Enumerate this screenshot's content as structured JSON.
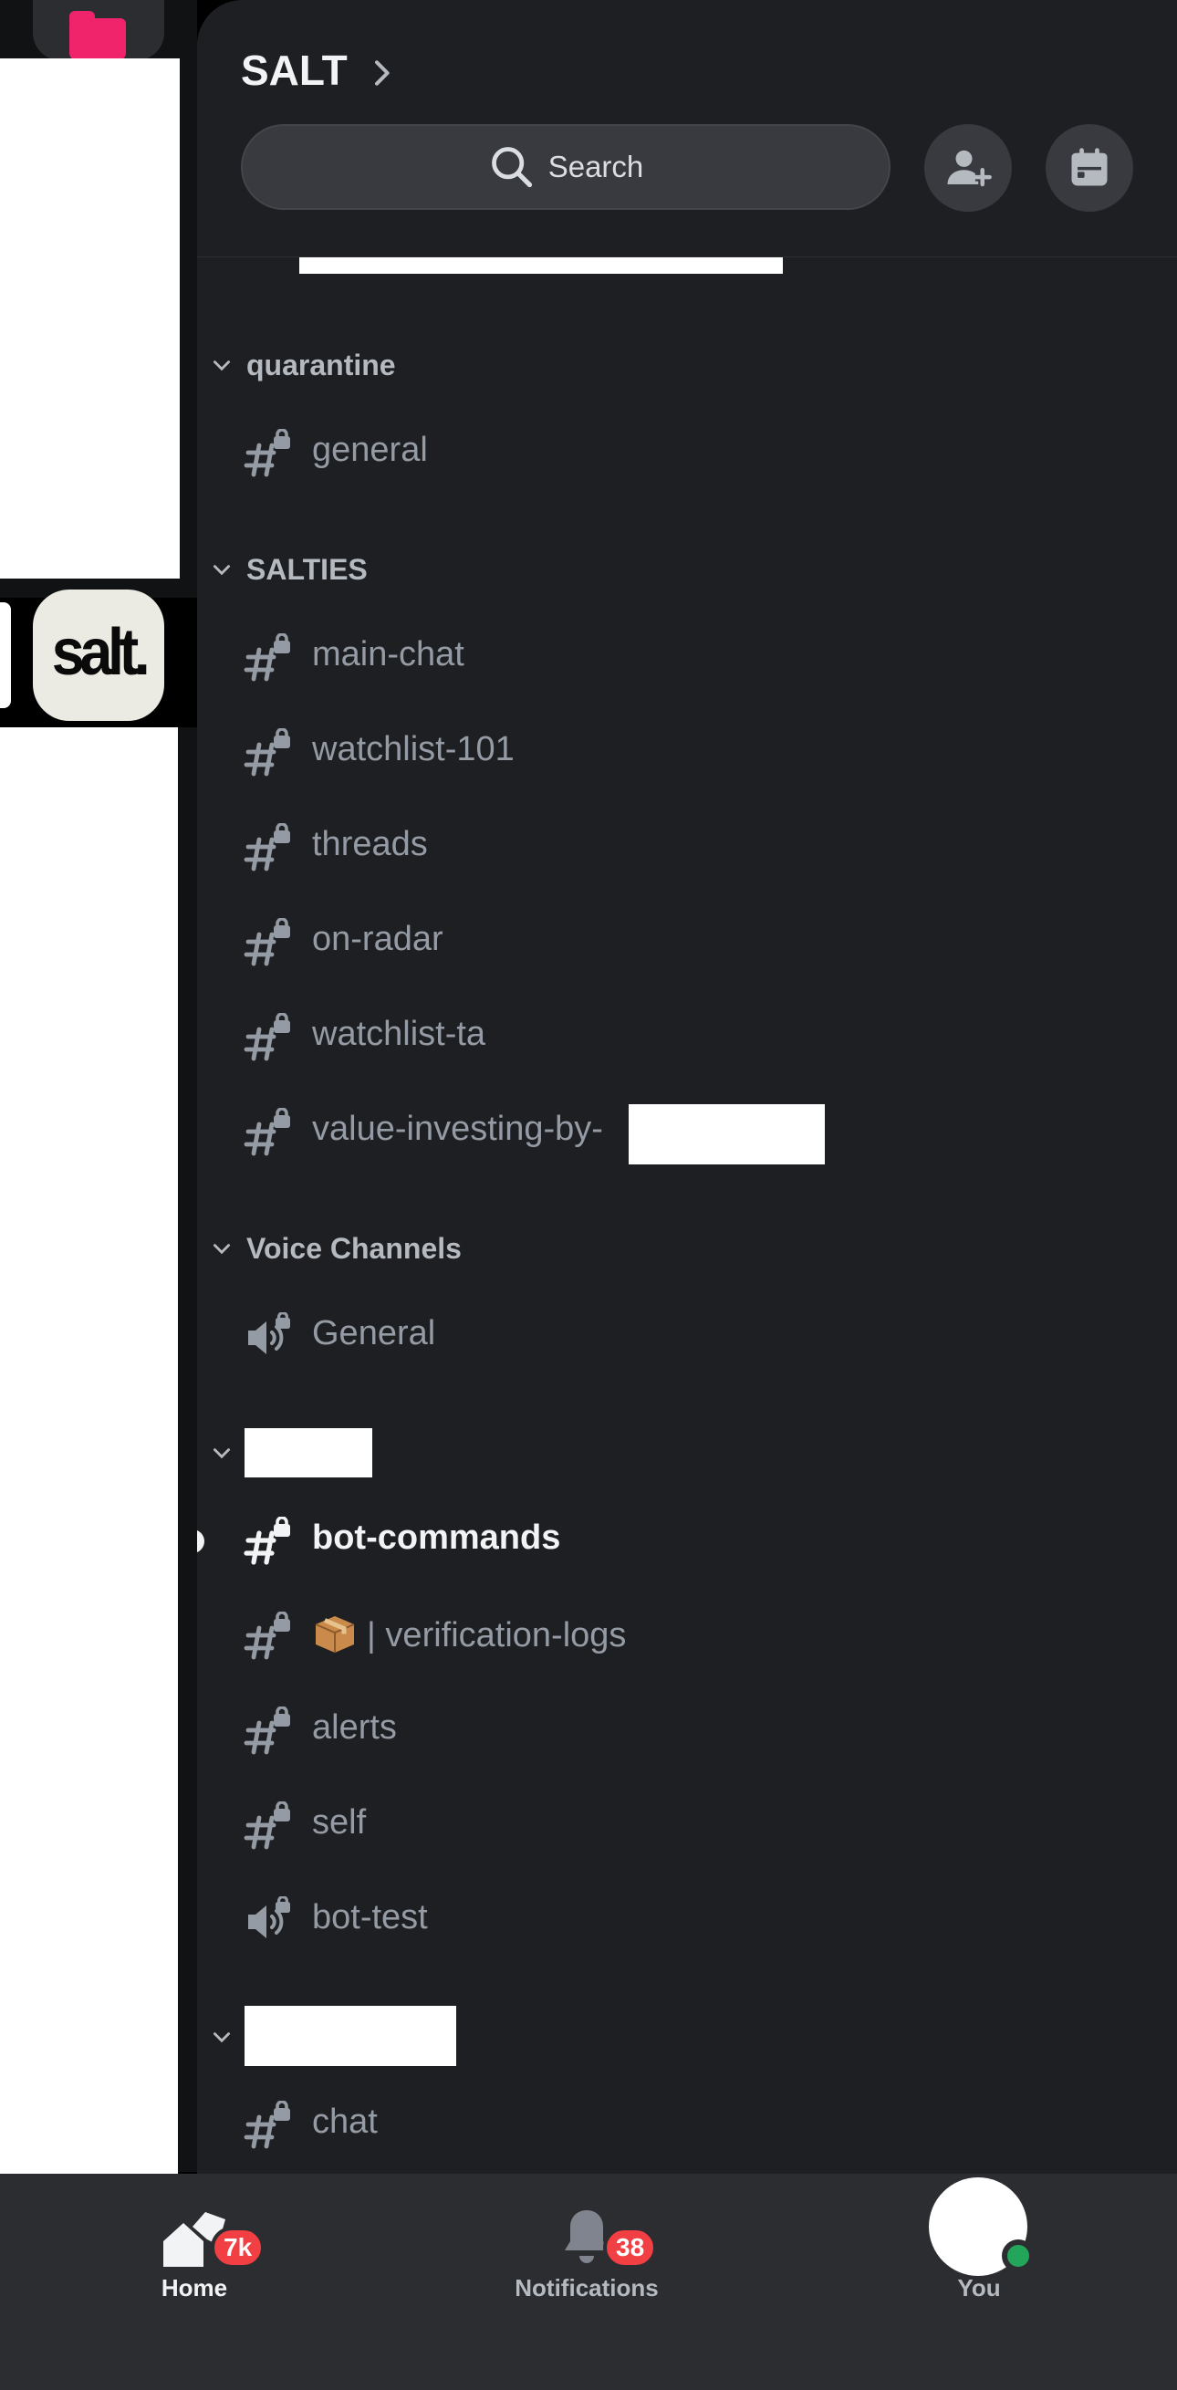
{
  "server": {
    "name": "SALT",
    "icon_text": "salt."
  },
  "search": {
    "label": "Search"
  },
  "actions": {
    "invite_icon": "add-member-icon",
    "events_icon": "calendar-icon"
  },
  "categories": {
    "quarantine": {
      "label": "quarantine",
      "channels": [
        {
          "name": "general",
          "type": "text-locked"
        }
      ]
    },
    "salties": {
      "label": "SALTIES",
      "channels": [
        {
          "name": "main-chat",
          "type": "text-locked"
        },
        {
          "name": "watchlist-101",
          "type": "text-locked"
        },
        {
          "name": "threads",
          "type": "text-locked"
        },
        {
          "name": "on-radar",
          "type": "text-locked"
        },
        {
          "name": "watchlist-ta",
          "type": "text-locked"
        },
        {
          "name": "value-investing-by-",
          "type": "text-locked"
        }
      ]
    },
    "voice": {
      "label": "Voice Channels",
      "channels": [
        {
          "name": "General",
          "type": "voice-locked"
        }
      ]
    },
    "bots": {
      "label": "",
      "channels": [
        {
          "name": "bot-commands",
          "type": "text-locked",
          "unread": true
        },
        {
          "name": "| verification-logs",
          "type": "text-locked",
          "emoji": "package"
        },
        {
          "name": "alerts",
          "type": "text-locked"
        },
        {
          "name": "self",
          "type": "text-locked"
        },
        {
          "name": "bot-test",
          "type": "voice-locked"
        }
      ]
    },
    "last": {
      "label": "",
      "channels": [
        {
          "name": "chat",
          "type": "text-locked"
        }
      ]
    }
  },
  "nav": {
    "home": {
      "label": "Home",
      "badge": "7k"
    },
    "notifications": {
      "label": "Notifications",
      "badge": "38"
    },
    "you": {
      "label": "You"
    }
  },
  "colors": {
    "background": "#1e1f22",
    "rail": "#111214",
    "nav": "#2b2d31",
    "badge": "#f23f43",
    "online": "#23a55a",
    "folder": "#f0246a"
  }
}
